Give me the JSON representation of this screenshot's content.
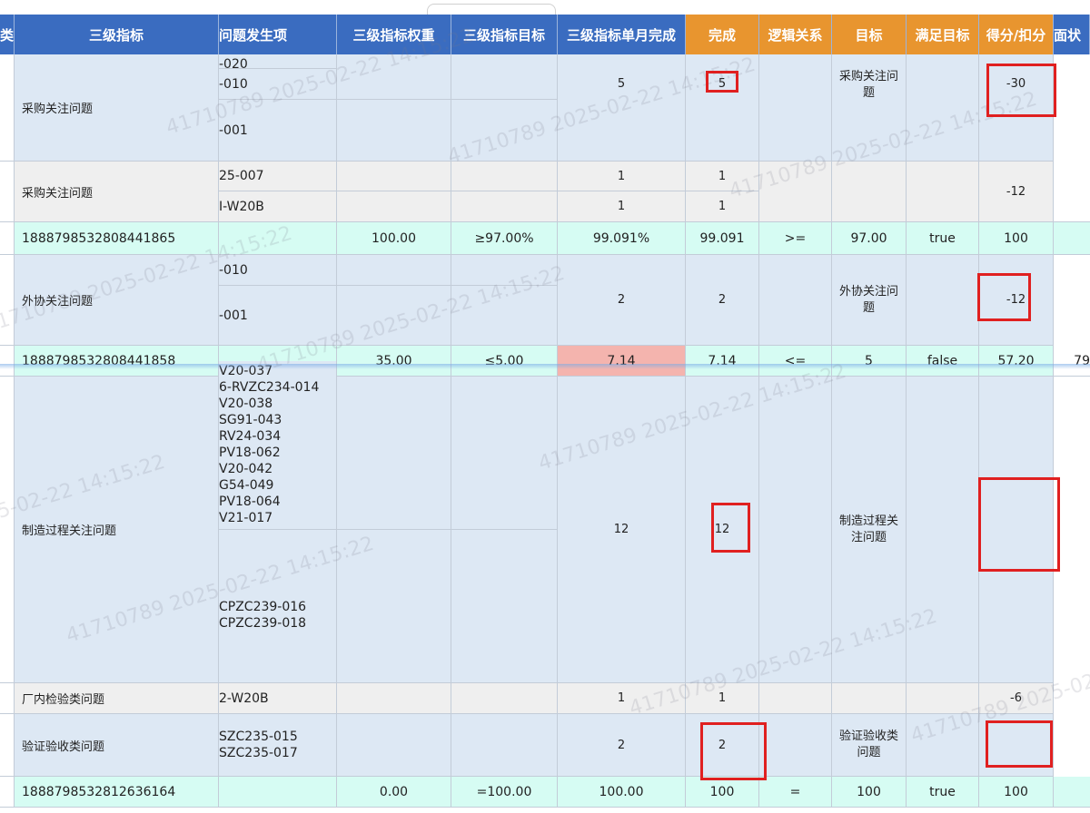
{
  "headers": [
    {
      "label": "类",
      "color": "blue"
    },
    {
      "label": "三级指标",
      "color": "blue"
    },
    {
      "label": "问题发生项",
      "color": "blue"
    },
    {
      "label": "三级指标权重",
      "color": "blue"
    },
    {
      "label": "三级指标目标",
      "color": "blue"
    },
    {
      "label": "三级指标单月完成",
      "color": "blue"
    },
    {
      "label": "完成",
      "color": "orange"
    },
    {
      "label": "逻辑关系",
      "color": "orange"
    },
    {
      "label": "目标",
      "color": "orange"
    },
    {
      "label": "满足目标",
      "color": "orange"
    },
    {
      "label": "得分/扣分",
      "color": "orange"
    },
    {
      "label": "面状",
      "color": "blue"
    }
  ],
  "watermark": "41710789 2025-02-22 14:15:22",
  "rows": {
    "r1": {
      "indicator": "采购关注问题",
      "items": [
        "-020",
        "-010",
        "-001"
      ],
      "monthly": "5",
      "done": "5",
      "target": "采购关注问题",
      "score": "-30"
    },
    "r2": {
      "indicator": "采购关注问题",
      "items": [
        "25-007",
        "I-W20B"
      ],
      "monthly": [
        "1",
        "1"
      ],
      "done": [
        "1",
        "1"
      ],
      "score": "-12"
    },
    "r3": {
      "indicator": "1888798532808441865",
      "weight": "100.00",
      "goal": "≥97.00%",
      "monthly": "99.091%",
      "done": "99.091",
      "logic": ">=",
      "target": "97.00",
      "meets": "true",
      "score": "100"
    },
    "r4": {
      "indicator": "外协关注问题",
      "items": [
        "-010",
        "-001"
      ],
      "monthly": "2",
      "done": "2",
      "target": "外协关注问题",
      "score": "-12"
    },
    "r5": {
      "indicator": "1888798532808441858",
      "weight": "35.00",
      "goal": "≤5.00",
      "monthly": "7.14",
      "done": "7.14",
      "logic": "<=",
      "target": "5",
      "meets": "false",
      "score": "57.20",
      "extra": "79"
    },
    "r6": {
      "indicator": "制造过程关注问题",
      "items_a": [
        "V20-037",
        "6-RVZC234-014",
        "V20-038",
        "SG91-043",
        "RV24-034",
        "PV18-062",
        "V20-042",
        "G54-049",
        "PV18-064",
        "V21-017"
      ],
      "items_b": [
        "CPZC239-016",
        "CPZC239-018"
      ],
      "monthly": "12",
      "done": "12",
      "target": "制造过程关注问题"
    },
    "r7": {
      "indicator": "厂内检验类问题",
      "items": [
        "2-W20B"
      ],
      "monthly": "1",
      "done": "1",
      "score": "-6"
    },
    "r8": {
      "indicator": "验证验收类问题",
      "items": [
        "SZC235-015",
        "SZC235-017"
      ],
      "monthly": "2",
      "done": "2",
      "target": "验证验收类问题"
    },
    "r9": {
      "indicator": "1888798532812636164",
      "weight": "0.00",
      "goal": "=100.00",
      "monthly": "100.00",
      "done": "100",
      "logic": "=",
      "target": "100",
      "meets": "true",
      "score": "100"
    }
  }
}
